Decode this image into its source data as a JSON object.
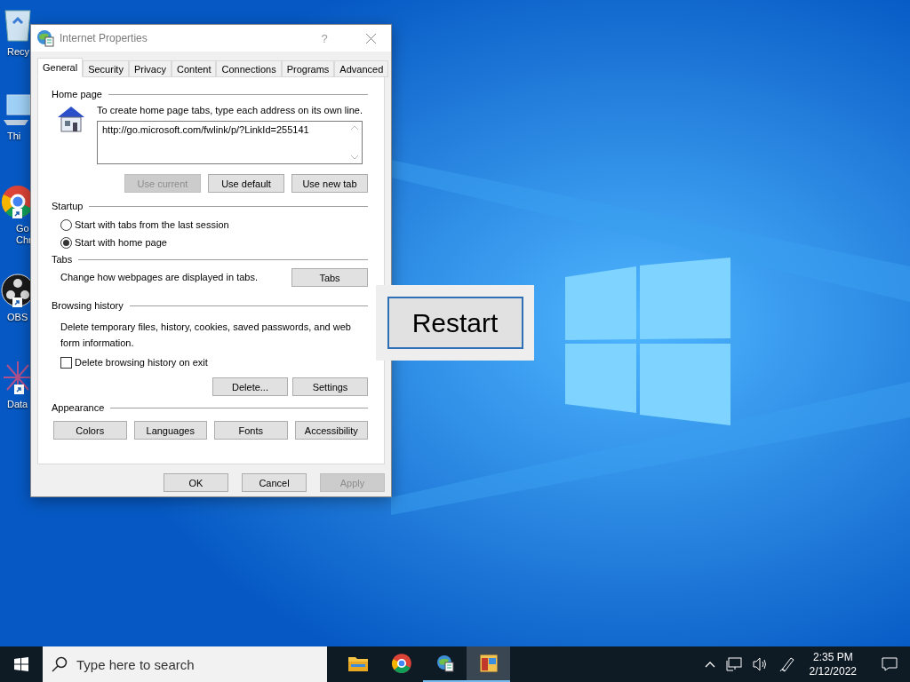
{
  "desktop_icons": [
    {
      "kind": "bin",
      "lines": [
        "Recy"
      ]
    },
    {
      "kind": "pc",
      "lines": [
        "Thi"
      ]
    },
    {
      "kind": "chrome",
      "lines": [
        "Go",
        "Chr"
      ]
    },
    {
      "kind": "obs",
      "lines": [
        "OBS"
      ]
    },
    {
      "kind": "data",
      "lines": [
        "Data"
      ]
    }
  ],
  "dialog": {
    "title": "Internet Properties",
    "help": "?",
    "tabs": [
      {
        "label": "General",
        "selected": true
      },
      {
        "label": "Security",
        "selected": false
      },
      {
        "label": "Privacy",
        "selected": false
      },
      {
        "label": "Content",
        "selected": false
      },
      {
        "label": "Connections",
        "selected": false
      },
      {
        "label": "Programs",
        "selected": false
      },
      {
        "label": "Advanced",
        "selected": false
      }
    ],
    "home_page": {
      "heading": "Home page",
      "instruction": "To create home page tabs, type each address on its own line.",
      "value": "http://go.microsoft.com/fwlink/p/?LinkId=255141",
      "buttons": [
        {
          "label": "Use current",
          "disabled": true
        },
        {
          "label": "Use default",
          "disabled": false
        },
        {
          "label": "Use new tab",
          "disabled": false
        }
      ]
    },
    "startup": {
      "heading": "Startup",
      "options": [
        {
          "label": "Start with tabs from the last session",
          "selected": false
        },
        {
          "label": "Start with home page",
          "selected": true
        }
      ]
    },
    "tabs_section": {
      "heading": "Tabs",
      "description": "Change how webpages are displayed in tabs.",
      "button": "Tabs"
    },
    "browsing_history": {
      "heading": "Browsing history",
      "description": "Delete temporary files, history, cookies, saved passwords, and web form information.",
      "checkbox": {
        "label": "Delete browsing history on exit",
        "checked": false
      },
      "buttons": [
        "Delete...",
        "Settings"
      ]
    },
    "appearance": {
      "heading": "Appearance",
      "buttons": [
        "Colors",
        "Languages",
        "Fonts",
        "Accessibility"
      ]
    },
    "footer": [
      {
        "label": "OK",
        "disabled": false
      },
      {
        "label": "Cancel",
        "disabled": false
      },
      {
        "label": "Apply",
        "disabled": true
      }
    ]
  },
  "restart_button": "Restart",
  "taskbar": {
    "search_placeholder": "Type here to search",
    "apps": [
      {
        "kind": "folder",
        "running": false,
        "active": false
      },
      {
        "kind": "chrome",
        "running": false,
        "active": false
      },
      {
        "kind": "ie-settings",
        "running": true,
        "active": false
      },
      {
        "kind": "app",
        "running": true,
        "active": true
      }
    ],
    "time": "2:35 PM",
    "date": "2/12/2022"
  }
}
